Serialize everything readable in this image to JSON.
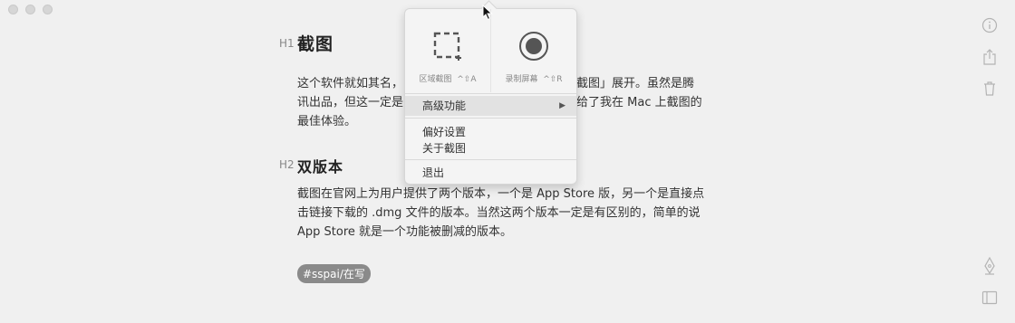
{
  "document": {
    "h1_marker": "H1",
    "h1_title": "截图",
    "para1_line1": "这个软件就如其名，",
    "para1_line1_right": "「截图」展开。虽然是腾",
    "para1_line2": "讯出品，但这一定是",
    "para1_line2_right": "给了我在 Mac 上截图的",
    "para1_line3": "最佳体验。",
    "h2_marker": "H2",
    "h2_title": "双版本",
    "para2_line1": "截图在官网上为用户提供了两个版本，一个是 App Store 版，另一个是直接点",
    "para2_line2": "击链接下载的 .dmg 文件的版本。当然这两个版本一定是有区别的，简单的说",
    "para2_line3": "App Store 就是一个功能被删减的版本。",
    "tag": "#sspai/在写"
  },
  "menu": {
    "tool_region_label": "区域截图",
    "tool_region_shortcut": "^⇧A",
    "tool_record_label": "录制屏幕",
    "tool_record_shortcut": "^⇧R",
    "advanced": "高级功能",
    "preferences": "偏好设置",
    "about": "关于截图",
    "quit": "退出"
  },
  "icons": {
    "toolbar": [
      "info-icon",
      "share-icon",
      "trash-icon",
      "pen-icon",
      "book-icon"
    ],
    "menu": [
      "region-select-icon",
      "record-icon",
      "submenu-arrow-icon"
    ],
    "window": [
      "close-button",
      "minimize-button",
      "zoom-button"
    ]
  },
  "colors": {
    "background": "#f0f0f0",
    "menu_bg": "#f4f4f4",
    "tag_bg": "#8a8a8a",
    "text": "#333333",
    "icon": "#b3b3b3"
  }
}
